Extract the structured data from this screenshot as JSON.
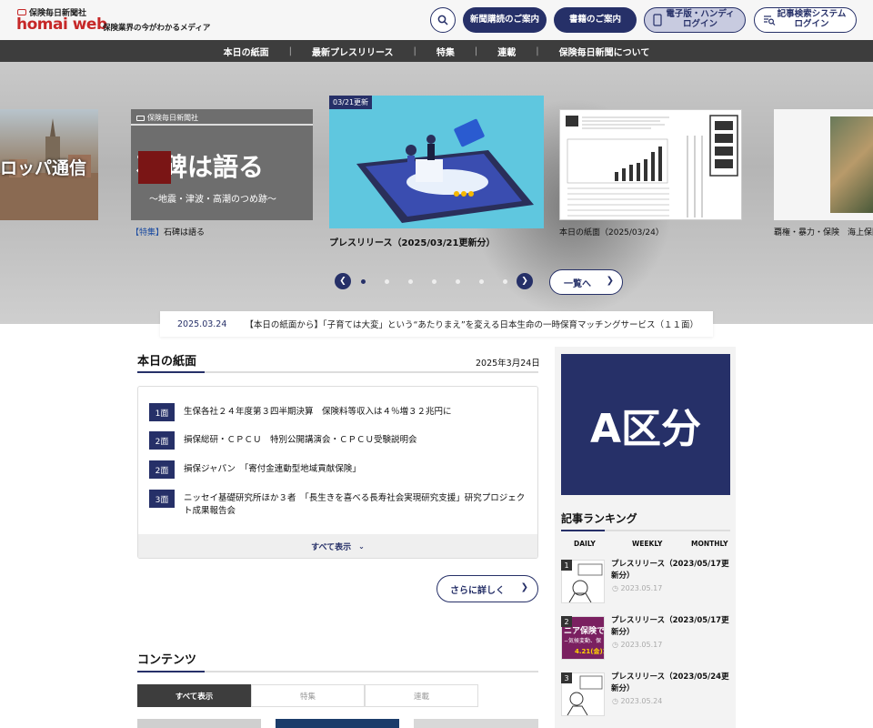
{
  "header": {
    "logo_sub": "保険毎日新聞社",
    "logo_main": "homai web",
    "tagline": "保険業界の今がわかるメディア",
    "buttons": {
      "subscribe": "新聞購読のご案内",
      "books": "書籍のご案内",
      "digital": "電子版・ハンディ\nログイン",
      "article_search": "記事検索システム\nログイン"
    }
  },
  "nav": [
    "本日の紙面",
    "最新プレスリリース",
    "特集",
    "連載",
    "保険毎日新聞について"
  ],
  "carousel": {
    "slides": [
      {
        "image_text": "ロッパ通信",
        "caption": ""
      },
      {
        "image_header": "保険毎日新聞社",
        "image_title": "石碑は語る",
        "image_sub": "〜地震・津波・高潮のつめ跡〜",
        "tag": "【特集】",
        "caption": "石碑は語る"
      },
      {
        "badge": "03/21更新",
        "caption": "プレスリリース（2025/03/21更新分）"
      },
      {
        "caption": "本日の紙面（2025/03/24）"
      },
      {
        "caption": "覇権・暴力・保険　海上保険の"
      }
    ],
    "list_button": "一覧へ",
    "dot_count": 8,
    "active_dot": 0
  },
  "ticker": {
    "date": "2025.03.24",
    "text": "【本日の紙面から】「子育ては大変」という“あたりまえ”を変える日本生命の一時保育マッチングサービス（１１面）"
  },
  "todays_paper": {
    "title": "本日の紙面",
    "date": "2025年3月24日",
    "items": [
      {
        "page": "1面",
        "text": "生保各社２４年度第３四半期決算　保険料等収入は４％増３２兆円に"
      },
      {
        "page": "2面",
        "text": "損保総研・ＣＰＣＵ　特別公開講演会・ＣＰＣＵ受験説明会"
      },
      {
        "page": "2面",
        "text": "損保ジャパン　「寄付金連動型地域貢献保険」"
      },
      {
        "page": "3面",
        "text": "ニッセイ基礎研究所ほか３者　「長生きを喜べる長寿社会実現研究支援」研究プロジェクト成果報告会"
      }
    ],
    "show_all": "すべて表示",
    "more": "さらに詳しく"
  },
  "contents": {
    "title": "コンテンツ",
    "tabs": [
      "すべて表示",
      "特集",
      "連載"
    ],
    "active_tab": 0
  },
  "sidebar": {
    "ad_text": "A区分",
    "ranking_title": "記事ランキング",
    "ranking_tabs": [
      "DAILY",
      "WEEKLY",
      "MONTHLY"
    ],
    "ranking": [
      {
        "rank": "1",
        "title": "プレスリリース（2023/05/17更新分）",
        "date": "2023.05.17"
      },
      {
        "rank": "2",
        "title": "プレスリリース（2023/05/17更新分）",
        "date": "2023.05.17",
        "thumb_text": "ニア保険で",
        "thumb_sub": "−気候変動、保",
        "thumb_date": "4.21(金)1"
      },
      {
        "rank": "3",
        "title": "プレスリリース（2023/05/24更新分）",
        "date": "2023.05.24"
      }
    ]
  },
  "colors": {
    "navy": "#263068",
    "brand_red": "#c62828",
    "nav_bg": "#3d3d3d"
  }
}
